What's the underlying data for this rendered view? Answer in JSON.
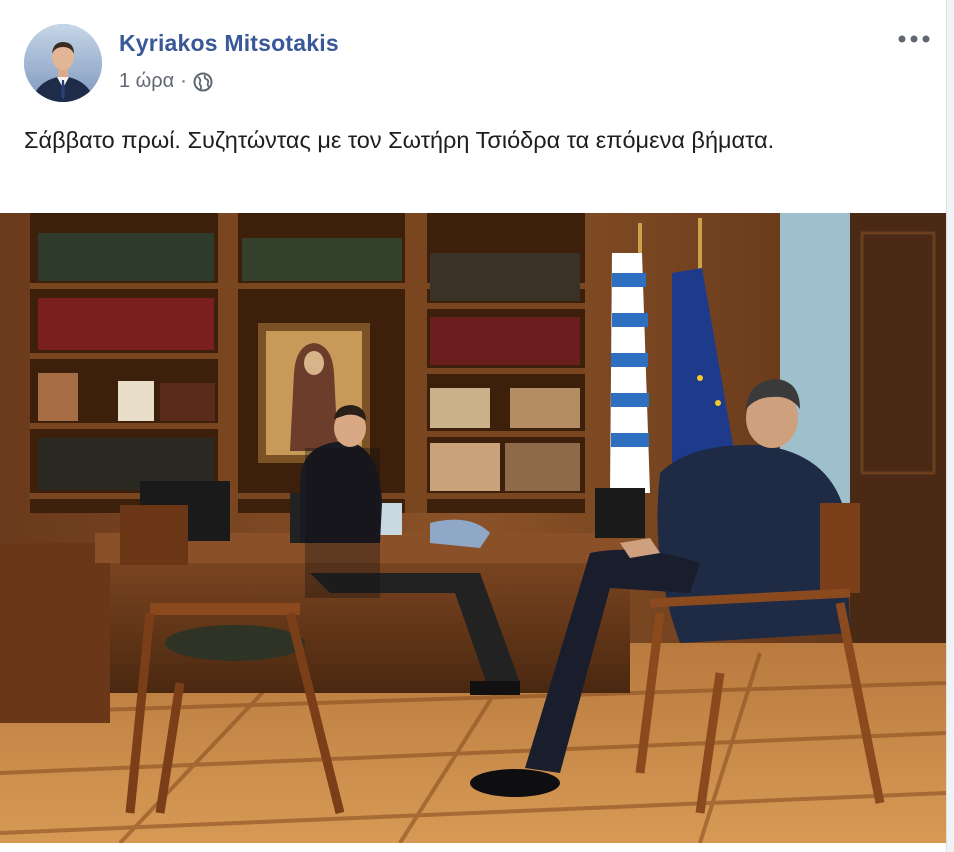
{
  "post": {
    "author": "Kyriakos Mitsotakis",
    "time": "1 ώρα",
    "separator": "·",
    "privacy_icon": "globe-icon",
    "more_icon": "more-options-icon",
    "text": "Σάββατο πρωί. Συζητώντας με τον Σωτήρη Τσιόδρα τα επόμενα βήματα."
  },
  "colors": {
    "author_link": "#385898",
    "meta": "#606770",
    "text": "#1c1e21"
  }
}
